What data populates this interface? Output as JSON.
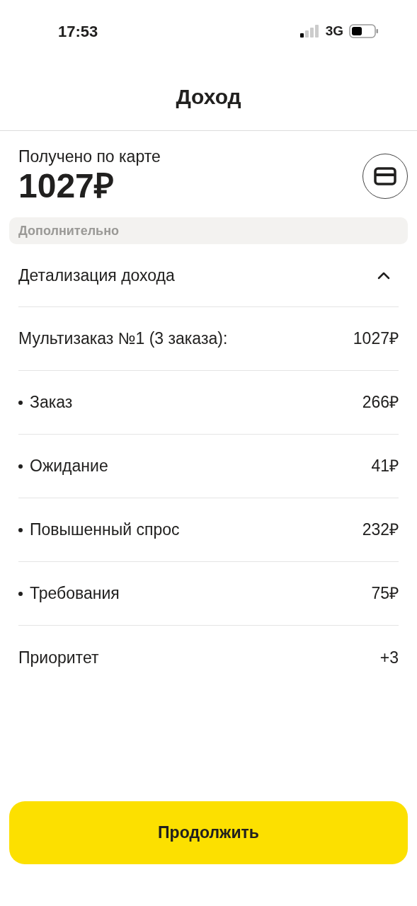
{
  "status_bar": {
    "time": "17:53",
    "network": "3G"
  },
  "header": {
    "title": "Доход"
  },
  "summary": {
    "label": "Получено по карте",
    "amount": "1027₽"
  },
  "extra_label": "Дополнительно",
  "details": {
    "title": "Детализация дохода",
    "expanded": true,
    "rows": [
      {
        "kind": "main",
        "label": "Мультизаказ №1 (3 заказа):",
        "value": "1027₽"
      },
      {
        "kind": "sub",
        "label": "Заказ",
        "value": "266₽"
      },
      {
        "kind": "sub",
        "label": "Ожидание",
        "value": "41₽"
      },
      {
        "kind": "sub",
        "label": "Повышенный спрос",
        "value": "232₽"
      },
      {
        "kind": "sub",
        "label": "Требования",
        "value": "75₽"
      },
      {
        "kind": "main",
        "label": "Приоритет",
        "value": "+3"
      }
    ]
  },
  "button": "Продолжить"
}
